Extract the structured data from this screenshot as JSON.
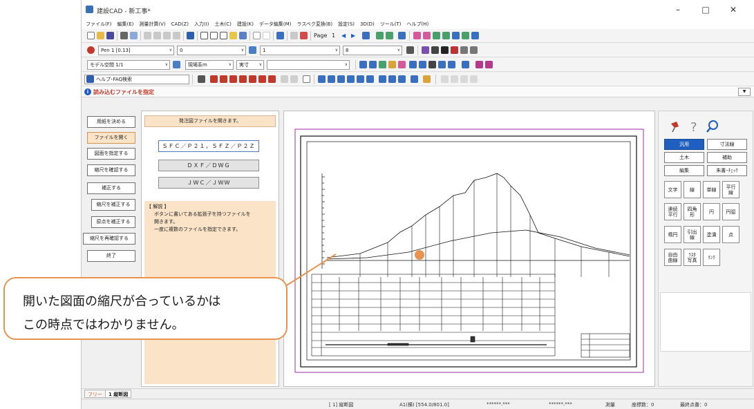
{
  "window": {
    "title": "建設CAD - 新工事*",
    "controls": {
      "minimize": "–",
      "maximize": "□",
      "close": "✕"
    }
  },
  "menu": [
    "ファイル(F)",
    "編集(E)",
    "測量計算(V)",
    "CAD(Z)",
    "入力(I)",
    "土木(C)",
    "建設(K)",
    "データ編集(M)",
    "ラスベク変換(B)",
    "設定(S)",
    "3D(D)",
    "ツール(T)",
    "ヘルプ(H)"
  ],
  "toolbar1": {
    "page_label": "Page",
    "page_number": "1"
  },
  "toolbar2": {
    "pen": "Pen 1 [0.13]",
    "layer": "0",
    "linetype": "1",
    "size": "8"
  },
  "toolbar3": {
    "space": "モデル空間 1/1",
    "coord": "現場系m",
    "scale": "実寸"
  },
  "toolbar4": {
    "help": "ヘルプ･FAQ検索"
  },
  "message": {
    "text": "読み込むファイルを指定",
    "info_glyph": "i"
  },
  "wizard": {
    "steps": [
      "用紙を決める",
      "ファイルを開く",
      "図面を指定する",
      "縮尺を確認する",
      "補正する",
      "縮尺を補正する",
      "原点を補正する",
      "縮尺を再確認する",
      "終了"
    ]
  },
  "description": {
    "header": "発注図ファイルを開きます。",
    "formats": [
      "ＳＦＣ／Ｐ２１，ＳＦＺ／Ｐ２Ｚ",
      "ＤＸＦ／ＤＷＧ",
      "ＪＷＣ／ＪＷＷ"
    ],
    "explain_title": "【 解説 】",
    "explain_lines": [
      "ボタンに書いてある拡張子を持つファイルを",
      "開きます。",
      "一度に複数のファイルを指定できます。"
    ]
  },
  "palette": {
    "tabs": [
      "汎用",
      "寸法線",
      "土木",
      "補助",
      "編集",
      "朱書･ﾁｪｯｸ"
    ],
    "buttons": [
      "文字",
      "線",
      "単線",
      "平行\n線",
      "連続\n平行",
      "四角\n形",
      "円",
      "円弧",
      "楕円",
      "引出\n線",
      "塗潰",
      "点",
      "自由\n曲線",
      "ﾗｽﾀ\n写真",
      "ﾘﾝｸ"
    ]
  },
  "tabs": [
    "フリー",
    "1 縦断図"
  ],
  "status": {
    "drawing": "[ 1] 縦断図",
    "paper": "A1(横) [554.0/801.0]",
    "coord_x": "******.***",
    "coord_y": "******.***",
    "mode": "測量",
    "coords_count": "座標数：0",
    "last_point": "最終点番：0"
  },
  "callout": {
    "line1": "開いた図面の縮尺が合っているかは",
    "line2": "この時点ではわかりません。"
  },
  "colors": {
    "accent_orange": "#e8934f",
    "active_tab": "#1f5fbf",
    "wizard_active": "#fbe3c8",
    "drawing_border": "#a52aa5"
  }
}
